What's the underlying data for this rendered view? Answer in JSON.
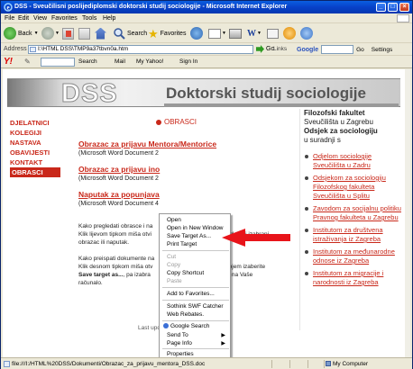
{
  "window": {
    "title": "DSS - Sveučilisni poslijediplomski doktorski studij sociologije - Microsoft Internet Explorer"
  },
  "menu": [
    "File",
    "Edit",
    "View",
    "Favorites",
    "Tools",
    "Help"
  ],
  "toolbar": {
    "back_label": "Back",
    "search_label": "Search",
    "favorites_label": "Favorites"
  },
  "address": {
    "label": "Address",
    "value": "I:\\HTML DSS\\TMP9a37tbvn0a.htm",
    "go_label": "Go",
    "links_label": "Links",
    "google_label": "Google",
    "google_go_label": "Go",
    "settings_label": "Settings"
  },
  "yahoo_bar": {
    "logo": "Y!",
    "search_label": "Search",
    "mail_label": "Mail",
    "my_yahoo_label": "My Yahoo!",
    "sign_in_label": "Sign In"
  },
  "site": {
    "banner_logo": "DSS",
    "banner_title": "Doktorski studij sociologije",
    "nav": [
      "DJELATNICI",
      "KOLEGIJI",
      "NASTAVA",
      "OBAVIJESTI",
      "KONTAKT",
      "OBRASCI"
    ],
    "active_nav": "OBRASCI",
    "crumb": "OBRASCI",
    "downloads": [
      {
        "title": "Obrazac za prijavu Mentora/Mentorice",
        "sub": "(Microsoft Word Document 2"
      },
      {
        "title": "Obrazac za prijavu ino",
        "sub": "(Microsoft Word Document 2"
      },
      {
        "title": "Naputak za popunjava",
        "sub": "(Microsoft Word Document 4"
      }
    ],
    "para1": "Kako pregledati obrasce i na                    Klik lijevom tipkom miša otvi                    pregledati izabrani obrazac ili naputak.",
    "para1_a": "Kako pregledati obrasce i na",
    "para1_b": "Klik lijevom tipkom miša otvi",
    "para1_b2": "pregledati izabrani",
    "para1_c": "obrazac ili naputak.",
    "para2_a": "Kako preispati dokumente na",
    "para2_b": "Klik desnom tipkom miša otv",
    "para2_b2": "u kojem izaberite",
    "para2_c_bold": "Save target as...",
    "para2_c": ", pa izabra",
    "para2_c2": "site na Vaše",
    "para2_d": "računalo.",
    "footer": "Last update: 14.01.2007. 17:25",
    "right_head": [
      "Filozofski fakultet",
      "Sveučilišta u Zagrebu",
      "Odsjek za sociologiju",
      "u suradnji s"
    ],
    "right_links": [
      "Odjelom sociologije Sveučilišta u Zadru",
      "Odsjekom za sociologiju Filozofskog fakulteta Sveučilišta u Splitu",
      "Zavodom za socijalnu politiku Pravnog fakulteta u Zagrebu",
      "Institutom za društvena istraživanja iz Zagreba",
      "Institutom za međunarodne odnose iz Zagreba",
      "Institutom za migracije i narodnosti iz Zagreba"
    ]
  },
  "context_menu": {
    "items": [
      {
        "label": "Open",
        "disabled": false
      },
      {
        "label": "Open in New Window",
        "disabled": false
      },
      {
        "label": "Save Target As...",
        "disabled": false
      },
      {
        "label": "Print Target",
        "disabled": false
      },
      {
        "label": "Cut",
        "disabled": true
      },
      {
        "label": "Copy",
        "disabled": true
      },
      {
        "label": "Copy Shortcut",
        "disabled": false
      },
      {
        "label": "Paste",
        "disabled": true
      },
      {
        "label": "Add to Favorites...",
        "disabled": false
      },
      {
        "label": "Sothink SWF Catcher",
        "disabled": false
      },
      {
        "label": "Web Rebates.",
        "disabled": false
      },
      {
        "label": "Google Search",
        "disabled": false
      },
      {
        "label": "Send To",
        "disabled": false
      },
      {
        "label": "Page Info",
        "disabled": false
      },
      {
        "label": "Properties",
        "disabled": false
      }
    ]
  },
  "status": {
    "url": "file:///I:/HTML%20DSS/Dokumenti/Obrazac_za_prijavu_mentora_DSS.doc",
    "zone": "My Computer"
  },
  "colors": {
    "accent": "#c9281a",
    "title_bar": "#0841c8",
    "arrow": "#e8141a"
  }
}
